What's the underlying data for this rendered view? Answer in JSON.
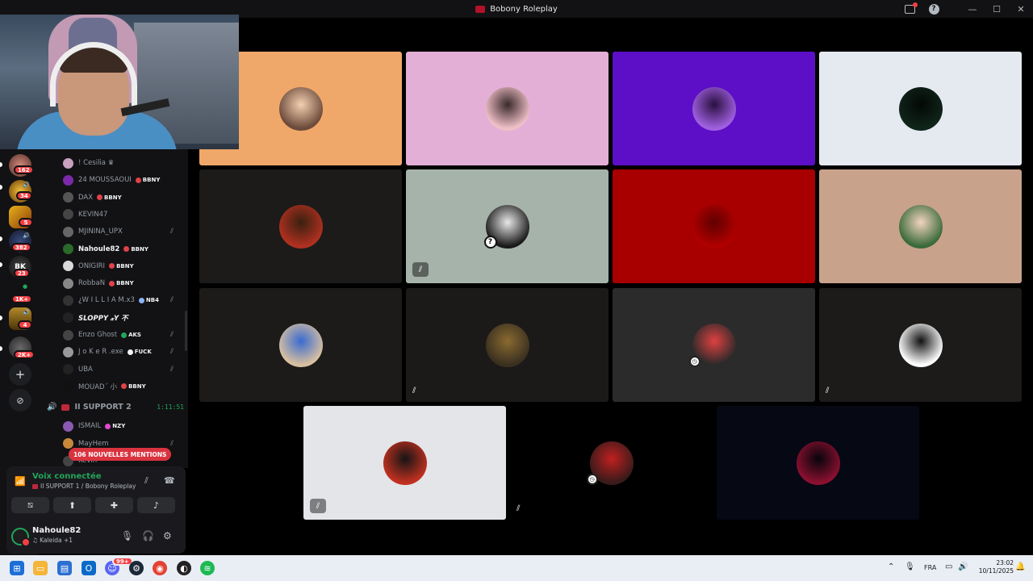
{
  "window": {
    "title": "Bobony Roleplay"
  },
  "rail": {
    "badges": [
      "162",
      "34",
      "5",
      "382",
      "23",
      "1K+",
      "4",
      "2K+"
    ]
  },
  "members": [
    {
      "name": "! Cesilia ♛",
      "tag": "",
      "online": false
    },
    {
      "name": "24 MOUSSAOUI",
      "tag": "BBNY",
      "online": false
    },
    {
      "name": "DAX",
      "tag": "BBNY",
      "online": false
    },
    {
      "name": "KEVIN47",
      "tag": "",
      "online": false
    },
    {
      "name": "MJININA_UPX",
      "tag": "",
      "online": false
    },
    {
      "name": "Nahoule82",
      "tag": "BBNY",
      "online": true
    },
    {
      "name": "ONIGIRI",
      "tag": "BBNY",
      "online": false
    },
    {
      "name": "RobbaN",
      "tag": "BBNY",
      "online": false
    },
    {
      "name": "¿W I L L I A M.x3",
      "tag": "NB4",
      "online": false
    },
    {
      "name": "SLOPPY 𝓍Y 不",
      "tag": "",
      "online": true
    },
    {
      "name": "Enzo Ghost",
      "tag": "AKS",
      "online": false
    },
    {
      "name": "J o K e R .exe",
      "tag": "FUCK",
      "online": false
    },
    {
      "name": "UBA",
      "tag": "",
      "online": false
    },
    {
      "name": "MOUAD´ 小",
      "tag": "BBNY",
      "online": false
    }
  ],
  "channel": {
    "name": "II SUPPORT 2",
    "timer": "1:11:51"
  },
  "channel_members": [
    {
      "name": "ISMAIL",
      "tag": "NZY"
    },
    {
      "name": "MayHem",
      "tag": ""
    },
    {
      "name": "Kevin",
      "tag": ""
    }
  ],
  "mentions": "106 NOUVELLES MENTIONS",
  "voice": {
    "status": "Voix connectée",
    "channel": "II SUPPORT 1 / Bobony Roleplay"
  },
  "user": {
    "name": "Nahoule82",
    "activity": "♫ Kaleida +1"
  },
  "tiles_row1": [
    "#f0a76a",
    "#e4afd6",
    "#5c0fc6",
    "#e5eaf1"
  ],
  "tiles_row2": [
    "#1c1b1a",
    "#a6b3aa",
    "#a80000",
    "#c9a28b"
  ],
  "tiles_row3": [
    "#1c1b1a",
    "#1c1a18",
    "#2b2b2b",
    "#1c1b1a"
  ],
  "tiles_row4": [
    "#e3e5e8",
    "#000000",
    "#060814"
  ],
  "taskbar": {
    "lang": "FRA",
    "time": "23:02",
    "date": "10/11/2025",
    "messenger_badge": "99+"
  }
}
